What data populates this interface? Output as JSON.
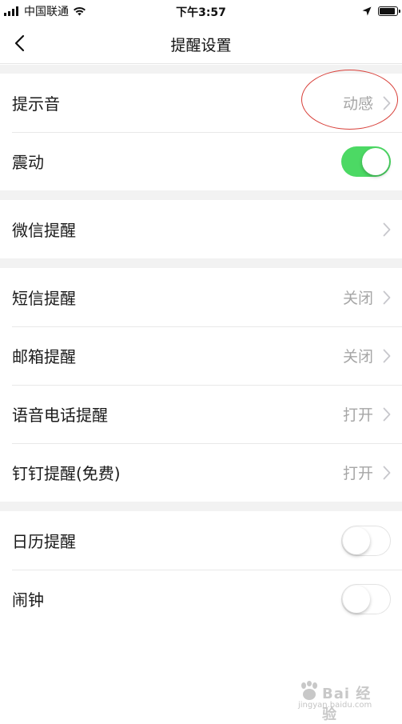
{
  "status_bar": {
    "carrier": "中国联通",
    "time": "下午3:57",
    "battery_level": 0.9
  },
  "nav": {
    "title": "提醒设置",
    "back_icon": "chevron-left-icon"
  },
  "groups": [
    {
      "rows": [
        {
          "label": "提示音",
          "value": "动感",
          "control": "chevron"
        },
        {
          "label": "震动",
          "control": "toggle",
          "state": "on"
        }
      ]
    },
    {
      "rows": [
        {
          "label": "微信提醒",
          "control": "chevron"
        }
      ]
    },
    {
      "rows": [
        {
          "label": "短信提醒",
          "value": "关闭",
          "control": "chevron"
        },
        {
          "label": "邮箱提醒",
          "value": "关闭",
          "control": "chevron"
        },
        {
          "label": "语音电话提醒",
          "value": "打开",
          "control": "chevron"
        },
        {
          "label": "钉钉提醒(免费)",
          "value": "打开",
          "control": "chevron"
        }
      ]
    },
    {
      "rows": [
        {
          "label": "日历提醒",
          "control": "toggle",
          "state": "off"
        },
        {
          "label": "闹钟",
          "control": "toggle",
          "state": "off"
        }
      ]
    }
  ],
  "colors": {
    "toggle_on": "#4cd964",
    "value_text": "#a6a6a6",
    "annotation_circle": "#d8403a",
    "background": "#f2f2f2"
  },
  "watermark": {
    "text": "Bai 经验",
    "sub": "jingyan.baidu.com"
  }
}
